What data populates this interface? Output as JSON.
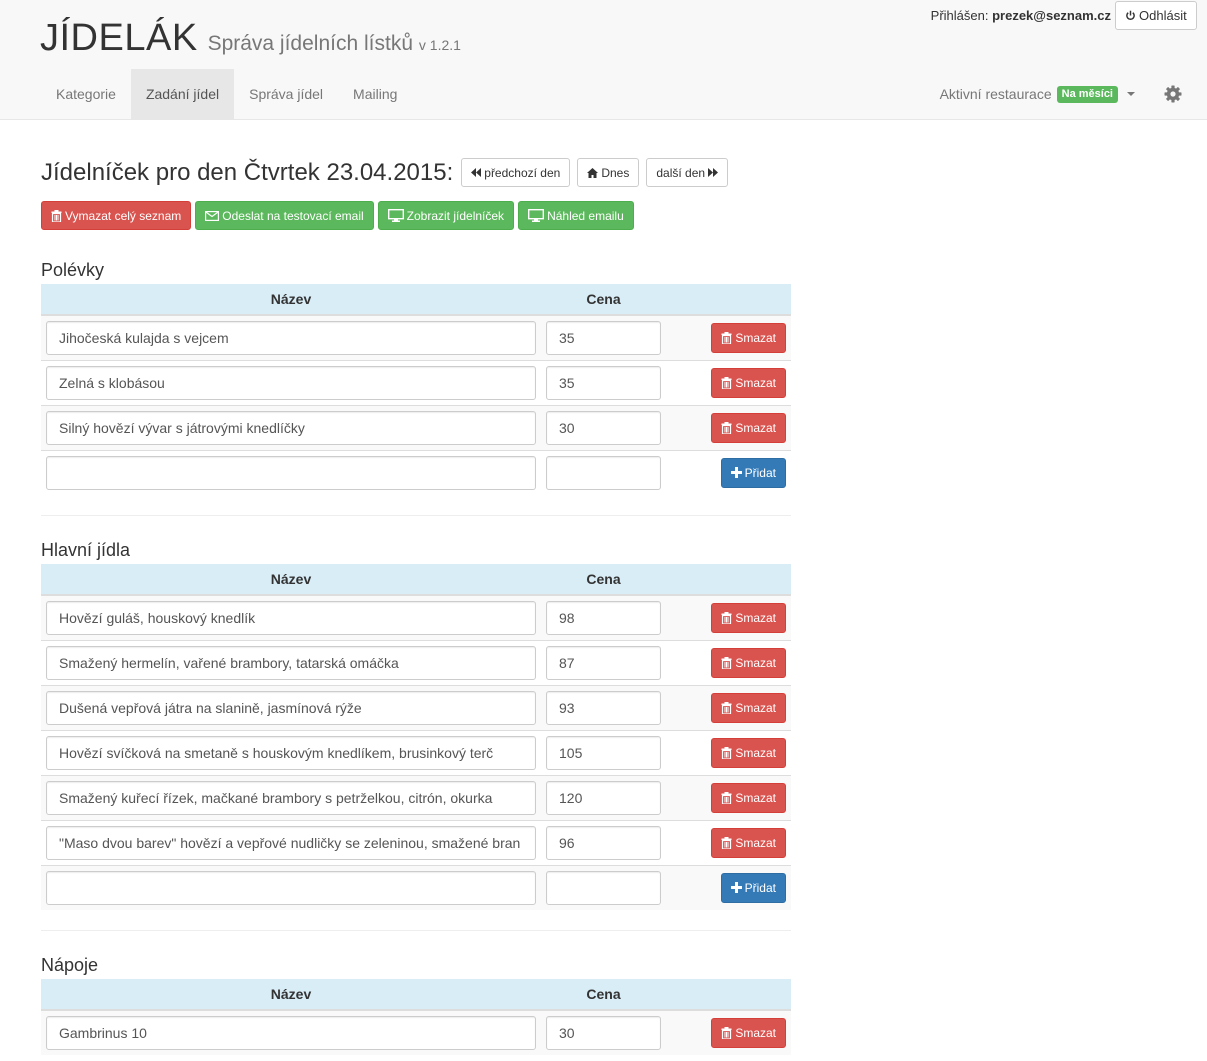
{
  "header": {
    "brand_title": "JÍDELÁK",
    "brand_subtitle": "Správa jídelních lístků",
    "version": "v 1.2.1",
    "login_prefix": "Přihlášen:",
    "login_user": "prezek@seznam.cz",
    "logout_label": "Odhlásit",
    "tabs": [
      {
        "label": "Kategorie",
        "active": false
      },
      {
        "label": "Zadání jídel",
        "active": true
      },
      {
        "label": "Správa jídel",
        "active": false
      },
      {
        "label": "Mailing",
        "active": false
      }
    ],
    "restaurant_label": "Aktivní restaurace",
    "restaurant_badge": "Na měsíci",
    "icons": {
      "logout": "power-icon",
      "settings": "gear-icon"
    }
  },
  "main": {
    "title": "Jídelníček pro den Čtvrtek 23.04.2015:",
    "prev_day": "předchozí den",
    "today": "Dnes",
    "next_day": "další den",
    "actions": {
      "clear_all": "Vymazat celý seznam",
      "send_test": "Odeslat na testovací email",
      "show_menu": "Zobrazit jídelníček",
      "preview_email": "Náhled emailu"
    },
    "col_name": "Název",
    "col_price": "Cena",
    "delete_label": "Smazat",
    "add_label": "Přidat"
  },
  "sections": [
    {
      "title": "Polévky",
      "rows": [
        {
          "name": "Jihočeská kulajda s vejcem",
          "price": "35"
        },
        {
          "name": "Zelná s klobásou",
          "price": "35"
        },
        {
          "name": "Silný hovězí vývar s játrovými knedlíčky",
          "price": "30"
        }
      ]
    },
    {
      "title": "Hlavní jídla",
      "rows": [
        {
          "name": "Hovězí guláš, houskový knedlík",
          "price": "98"
        },
        {
          "name": "Smažený hermelín, vařené brambory, tatarská omáčka",
          "price": "87"
        },
        {
          "name": "Dušená vepřová játra na slanině, jasmínová rýže",
          "price": "93"
        },
        {
          "name": "Hovězí svíčková na smetaně s houskovým knedlíkem, brusinkový terč",
          "price": "105"
        },
        {
          "name": "Smažený kuřecí řízek, mačkané brambory s petrželkou, citrón, okurka",
          "price": "120"
        },
        {
          "name": "\"Maso dvou barev\" hovězí a vepřové nudličky se zeleninou, smažené bran",
          "price": "96"
        }
      ]
    },
    {
      "title": "Nápoje",
      "rows": [
        {
          "name": "Gambrinus 10",
          "price": "30"
        }
      ]
    }
  ],
  "colors": {
    "danger": "#d9534f",
    "success": "#5cb85c",
    "primary": "#337ab7",
    "table_header": "#d9edf7"
  }
}
